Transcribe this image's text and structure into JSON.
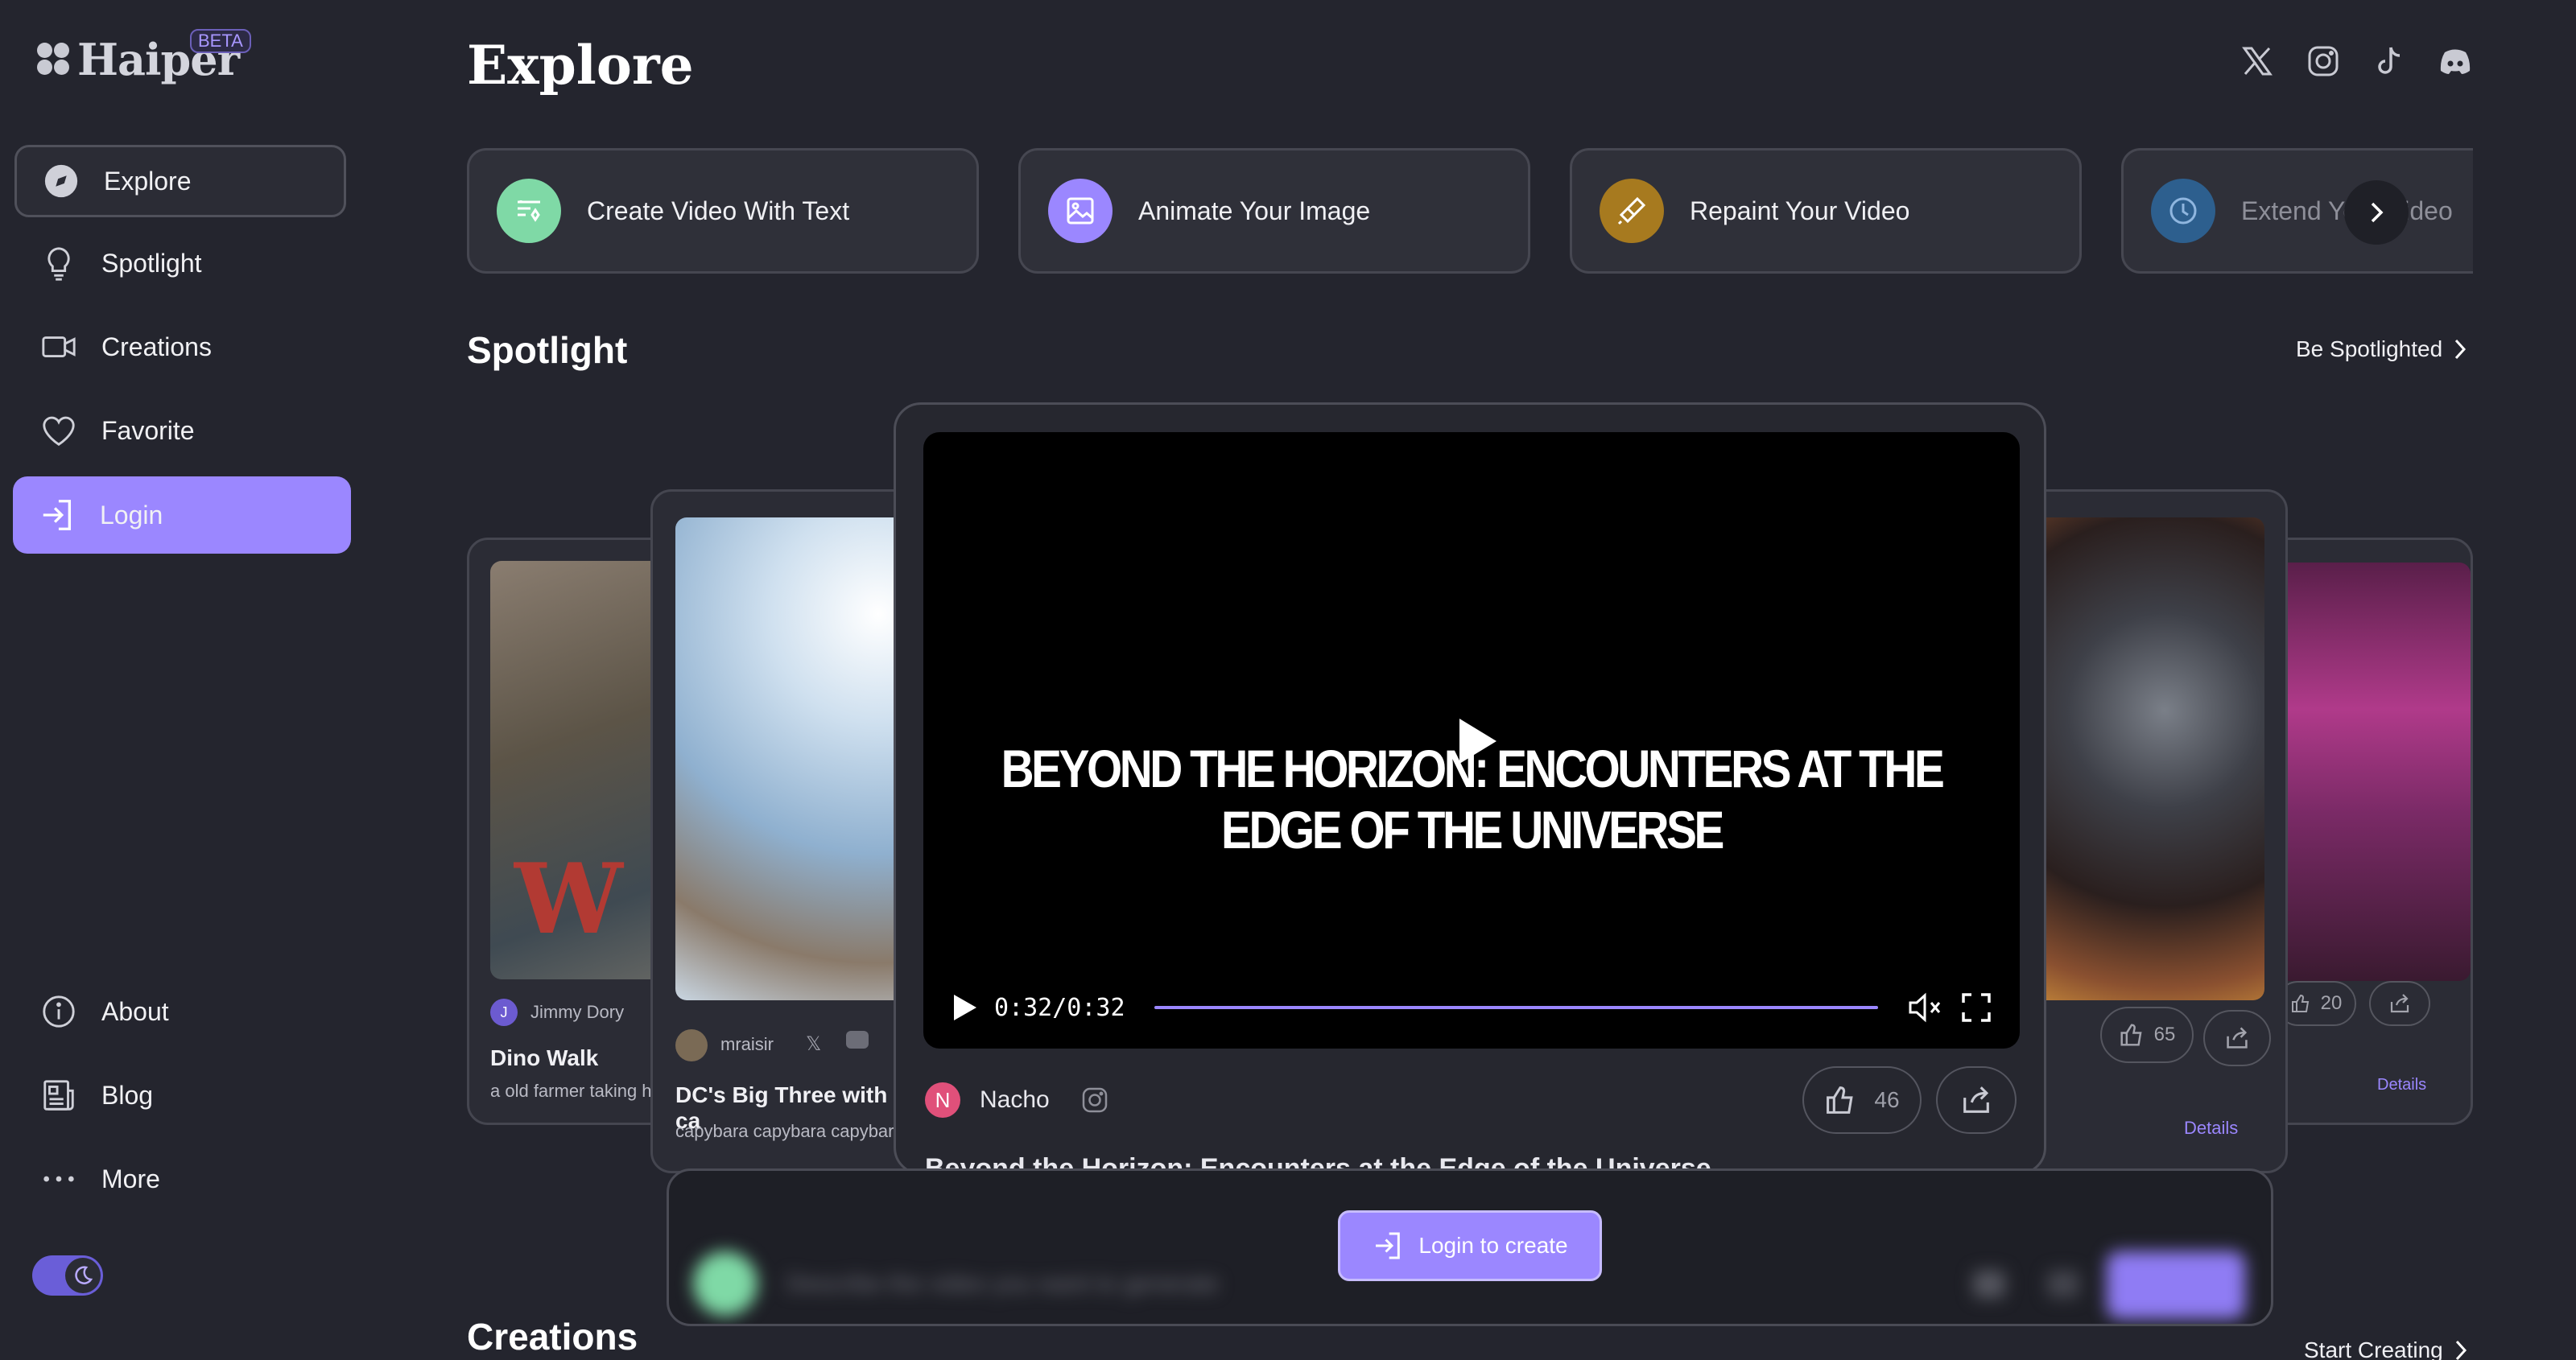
{
  "brand": {
    "name": "Haiper",
    "badge": "BETA"
  },
  "sidebar": {
    "items": [
      {
        "label": "Explore",
        "icon": "compass-icon",
        "active": true
      },
      {
        "label": "Spotlight",
        "icon": "lightbulb-icon"
      },
      {
        "label": "Creations",
        "icon": "video-camera-icon"
      },
      {
        "label": "Favorite",
        "icon": "heart-icon"
      },
      {
        "label": "Login",
        "icon": "login-icon"
      }
    ],
    "bottom_items": [
      {
        "label": "About",
        "icon": "info-icon"
      },
      {
        "label": "Blog",
        "icon": "newspaper-icon"
      },
      {
        "label": "More",
        "icon": "more-dots-icon"
      }
    ],
    "theme": "dark"
  },
  "header": {
    "title": "Explore",
    "socials": [
      "x-icon",
      "instagram-icon",
      "tiktok-icon",
      "discord-icon"
    ]
  },
  "quick_actions": [
    {
      "label": "Create Video With Text",
      "color": "#7fd9a6"
    },
    {
      "label": "Animate Your Image",
      "color": "#9b87ff"
    },
    {
      "label": "Repaint Your Video",
      "color": "#a77a1f"
    },
    {
      "label": "Extend Your Video",
      "color": "#2d5f8e"
    }
  ],
  "spotlight": {
    "title": "Spotlight",
    "link": "Be Spotlighted",
    "cards": [
      {
        "author": "Jimmy Dory",
        "title": "Dino Walk",
        "desc": "a old farmer taking his"
      },
      {
        "author": "mraisir",
        "title": "DC's Big Three with ca",
        "desc": "capybara capybara capybara"
      },
      {
        "likes": "65",
        "details": "Details"
      },
      {
        "likes": "20",
        "details": "Details"
      }
    ],
    "main": {
      "video_title": "BEYOND THE HORIZON: ENCOUNTERS AT THE EDGE OF THE UNIVERSE",
      "time": "0:32/0:32",
      "progress": 1.0,
      "author_initial": "N",
      "author": "Nacho",
      "likes": "46",
      "description": "Beyond the Horizon: Encounters at the Edge of the Universe"
    }
  },
  "prompt": {
    "placeholder": "Describe the video you want to generate",
    "login_label": "Login to create"
  },
  "creations": {
    "title": "Creations",
    "link": "Start Creating"
  },
  "colors": {
    "accent": "#9b87ff",
    "background": "#24252e",
    "card": "#2f3039"
  }
}
